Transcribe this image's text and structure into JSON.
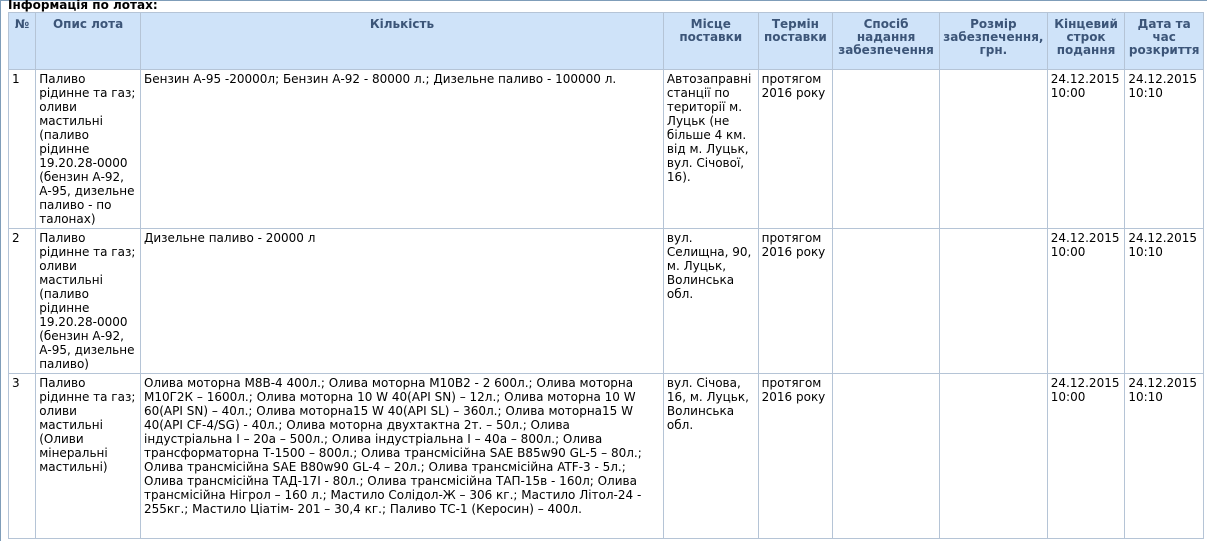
{
  "section": {
    "title": "Інформація по лотах:"
  },
  "table": {
    "headers": {
      "num": "№",
      "desc": "Опис лота",
      "qty": "Кількість",
      "place": "Місце поставки",
      "term": "Термін поставки",
      "secmethod": "Спосіб надання забезпечення",
      "secsize": "Розмір забезпечення, грн.",
      "deadline": "Кінцевий строк подання",
      "opening": "Дата та час розкриття"
    },
    "rows": [
      {
        "num": "1",
        "desc": "Паливо рідинне та газ; оливи мастильні (паливо рідинне 19.20.28-0000 (бензин А-92, А-95, дизельне паливо - по талонах)",
        "qty": "Бензин А-95 -20000л; Бензин А-92 - 80000 л.; Дизельне паливо - 100000 л.",
        "place": "Автозаправні станції по території м. Луцьк (не більше 4 км. від м. Луцьк, вул. Січової, 16).",
        "term": "протягом 2016 року",
        "secmethod": "",
        "secsize": "",
        "deadline": "24.12.2015 10:00",
        "opening": "24.12.2015 10:10"
      },
      {
        "num": "2",
        "desc": "Паливо рідинне та газ; оливи мастильні (паливо рідинне 19.20.28-0000 (бензин А-92, А-95, дизельне паливо)",
        "qty": "Дизельне паливо - 20000 л",
        "place": "вул. Селищна, 90, м. Луцьк, Волинська обл.",
        "term": "протягом 2016 року",
        "secmethod": "",
        "secsize": "",
        "deadline": "24.12.2015 10:00",
        "opening": "24.12.2015 10:10"
      },
      {
        "num": "3",
        "desc": "Паливо рідинне та газ; оливи мастильні (Оливи мінеральні мастильні)",
        "qty": "Олива моторна М8В-4 400л.; Олива моторна М10В2 - 2 600л.; Олива моторна М10Г2К – 1600л.; Олива моторна 10 W 40(API SN) – 12л.; Олива моторна 10 W 60(API SN) – 40л.; Олива моторна15 W 40(API SL) – 360л.; Олива моторна15 W 40(API CF-4/SG) - 40л.; Олива моторна двухтактна 2т. – 50л.; Олива індустріальна І – 20а – 500л.; Олива індустріальна І – 40а – 800л.; Олива трансформаторна Т-1500 – 800л.; Олива трансмісійна SAE B85w90 GL-5 – 80л.; Олива трансмісійна SAE B80w90 GL-4 – 20л.; Олива трансмісійна ATF-3 - 5л.; Олива трансмісійна ТАД-17І - 80л.; Олива трансмісійна ТАП-15в - 160л; Олива трансмісійна Нігрол – 160 л.; Мастило Солідол-Ж – 306 кг.; Мастило Літол-24 - 255кг.; Мастило Ціатім- 201 – 30,4 кг.; Паливо ТС-1 (Керосин) – 400л.",
        "place": "вул. Січова, 16, м. Луцьк, Волинська обл.",
        "term": "протягом 2016 року",
        "secmethod": "",
        "secsize": "",
        "deadline": "24.12.2015 10:00",
        "opening": "24.12.2015 10:10"
      }
    ]
  }
}
